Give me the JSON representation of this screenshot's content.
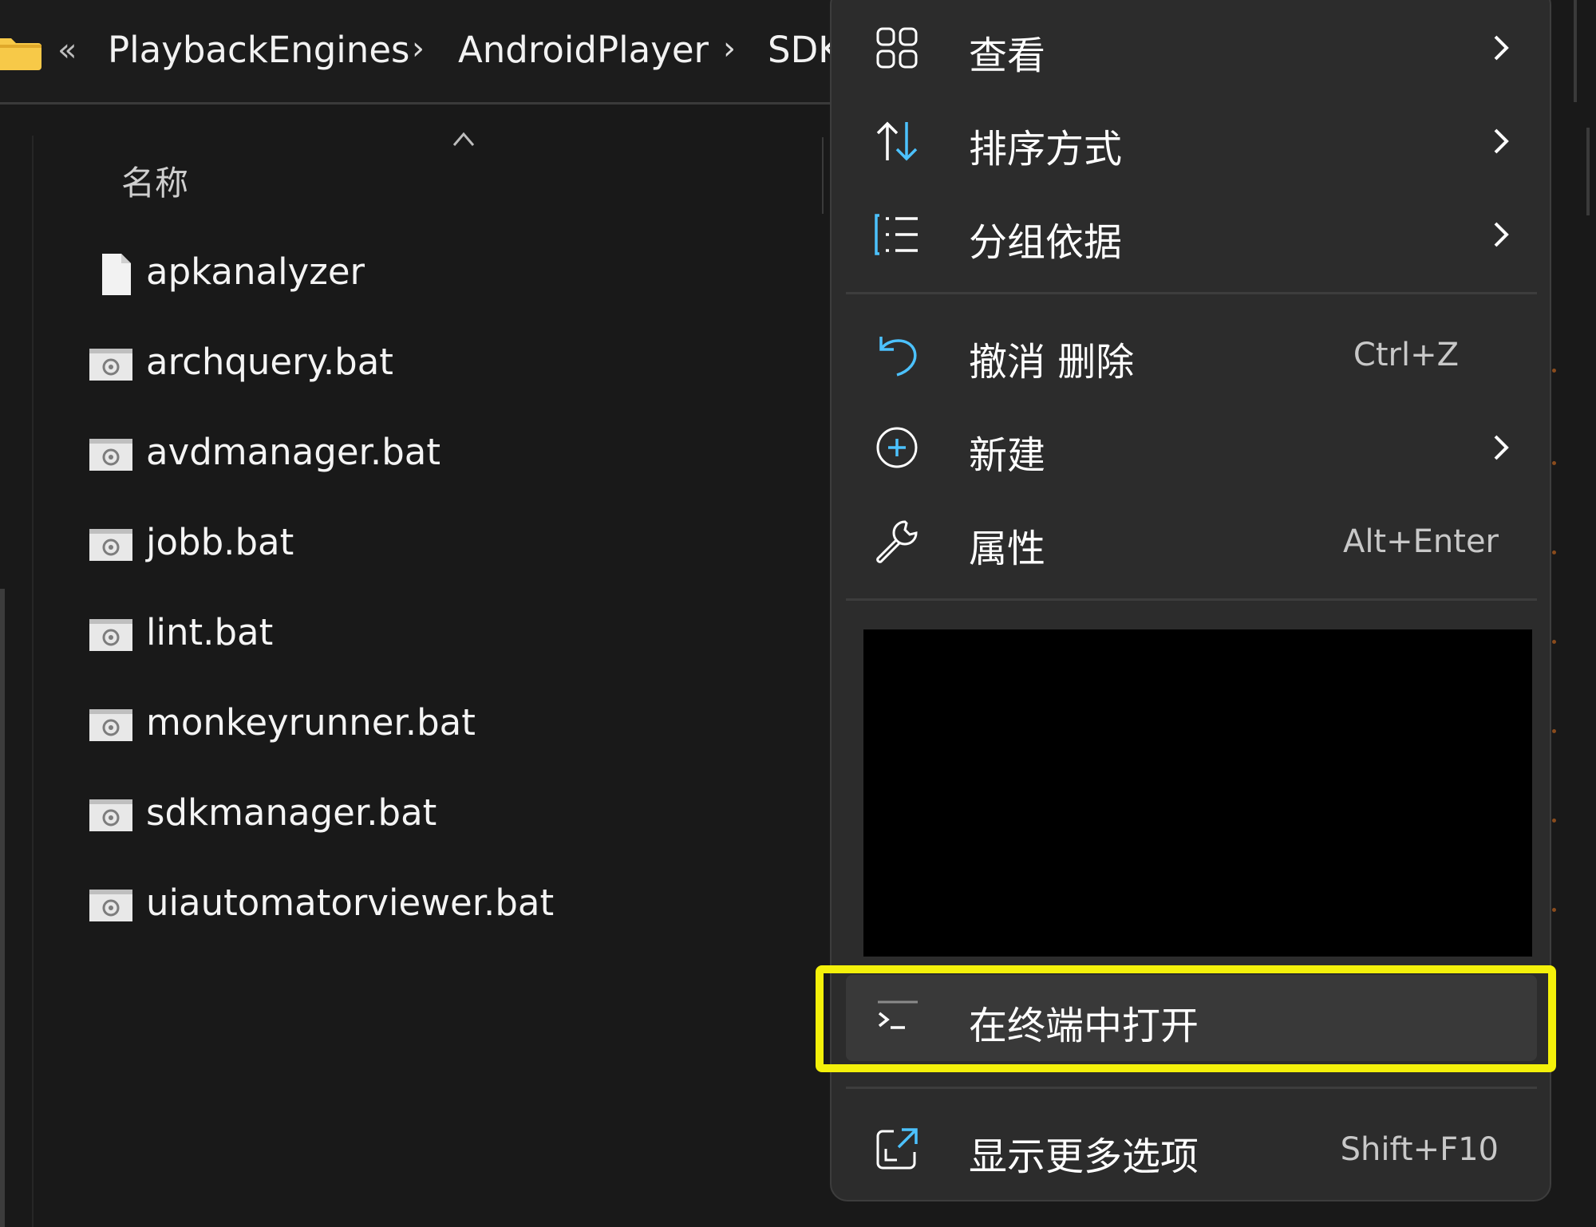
{
  "breadcrumb": {
    "overflow": "«",
    "items": [
      "PlaybackEngines",
      "AndroidPlayer",
      "SDK"
    ],
    "separator": "›"
  },
  "file_list": {
    "column_header": "名称",
    "files": [
      {
        "name": "apkanalyzer",
        "icon": "blank-file-icon"
      },
      {
        "name": "archquery.bat",
        "icon": "batch-file-icon"
      },
      {
        "name": "avdmanager.bat",
        "icon": "batch-file-icon"
      },
      {
        "name": "jobb.bat",
        "icon": "batch-file-icon"
      },
      {
        "name": "lint.bat",
        "icon": "batch-file-icon"
      },
      {
        "name": "monkeyrunner.bat",
        "icon": "batch-file-icon"
      },
      {
        "name": "sdkmanager.bat",
        "icon": "batch-file-icon"
      },
      {
        "name": "uiautomatorviewer.bat",
        "icon": "batch-file-icon"
      }
    ]
  },
  "context_menu": {
    "view": {
      "label": "查看",
      "icon": "grid-view-icon"
    },
    "sort": {
      "label": "排序方式",
      "icon": "sort-arrows-icon"
    },
    "group": {
      "label": "分组依据",
      "icon": "group-list-icon"
    },
    "undo": {
      "label": "撤消 删除",
      "shortcut": "Ctrl+Z",
      "icon": "undo-icon"
    },
    "new": {
      "label": "新建",
      "icon": "plus-circle-icon"
    },
    "properties": {
      "label": "属性",
      "shortcut": "Alt+Enter",
      "icon": "wrench-icon"
    },
    "open_terminal": {
      "label": "在终端中打开",
      "icon": "terminal-icon"
    },
    "more_options": {
      "label": "显示更多选项",
      "shortcut": "Shift+F10",
      "icon": "expand-icon"
    }
  },
  "colors": {
    "background": "#191919",
    "menu_background": "#2c2c2c",
    "accent_blue": "#4cc2ff",
    "highlight_yellow": "#f4f10a",
    "folder_yellow": "#f7c948"
  }
}
